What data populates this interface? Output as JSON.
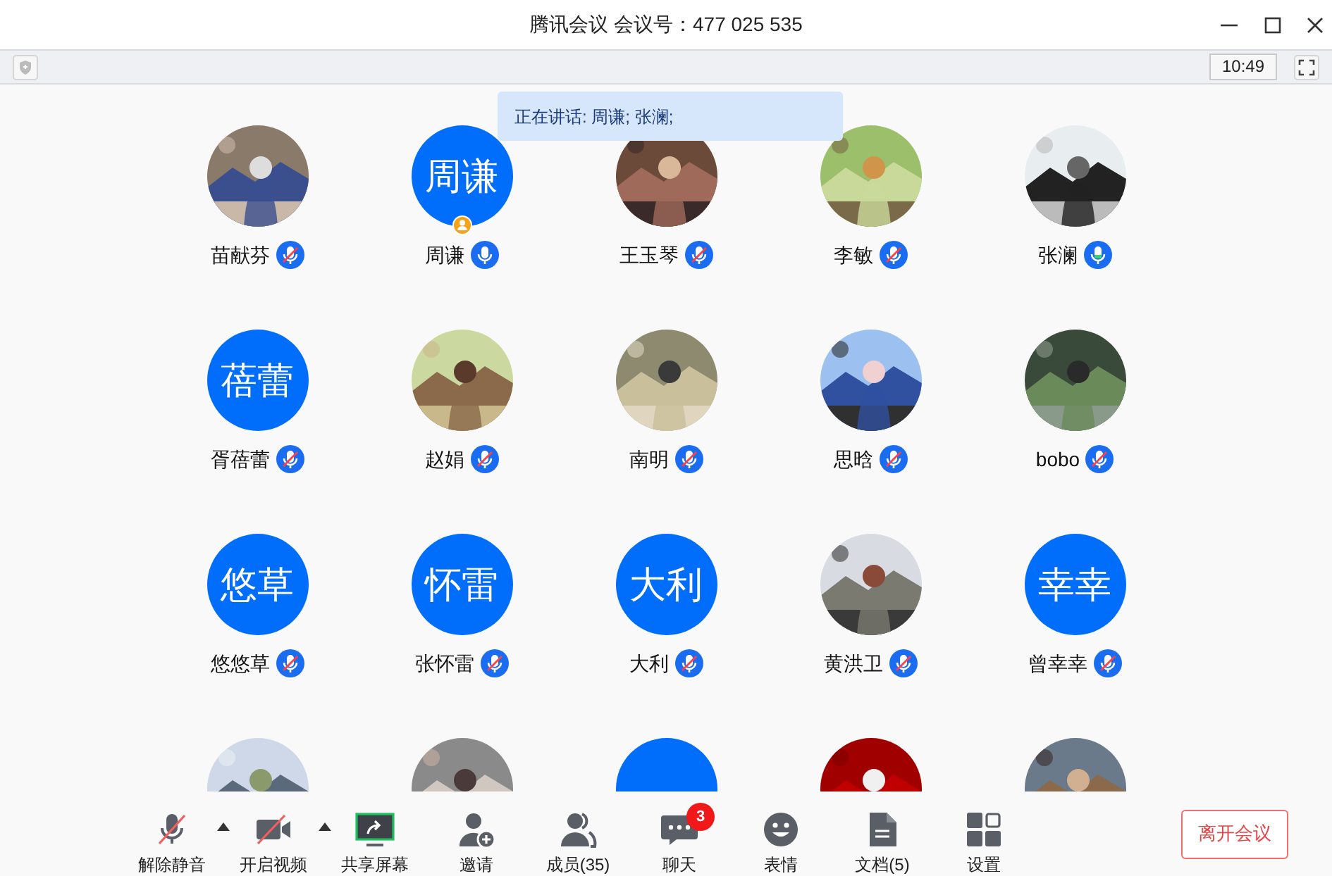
{
  "window": {
    "title": "腾讯会议 会议号：477 025 535"
  },
  "top_bar": {
    "time": "10:49"
  },
  "speaking_banner": "正在讲话: 周谦; 张澜;",
  "participants": [
    {
      "name": "苗献芬",
      "avatar": {
        "kind": "picture"
      },
      "muted": true,
      "host": false
    },
    {
      "name": "周谦",
      "avatar": {
        "kind": "initials",
        "text": "周谦"
      },
      "muted": false,
      "host": true
    },
    {
      "name": "王玉琴",
      "avatar": {
        "kind": "picture"
      },
      "muted": true,
      "host": false
    },
    {
      "name": "李敏",
      "avatar": {
        "kind": "picture"
      },
      "muted": true,
      "host": false
    },
    {
      "name": "张澜",
      "avatar": {
        "kind": "picture"
      },
      "muted": false,
      "host": false,
      "level": 0.3
    },
    {
      "name": "胥蓓蕾",
      "avatar": {
        "kind": "initials",
        "text": "蓓蕾"
      },
      "muted": true,
      "host": false
    },
    {
      "name": "赵娟",
      "avatar": {
        "kind": "picture"
      },
      "muted": true,
      "host": false
    },
    {
      "name": "南明",
      "avatar": {
        "kind": "picture"
      },
      "muted": true,
      "host": false
    },
    {
      "name": "思晗",
      "avatar": {
        "kind": "picture"
      },
      "muted": true,
      "host": false
    },
    {
      "name": "bobo",
      "avatar": {
        "kind": "picture"
      },
      "muted": true,
      "host": false
    },
    {
      "name": "悠悠草",
      "avatar": {
        "kind": "initials",
        "text": "悠草"
      },
      "muted": true,
      "host": false
    },
    {
      "name": "张怀雷",
      "avatar": {
        "kind": "initials",
        "text": "怀雷"
      },
      "muted": true,
      "host": false
    },
    {
      "name": "大利",
      "avatar": {
        "kind": "initials",
        "text": "大利"
      },
      "muted": true,
      "host": false
    },
    {
      "name": "黄洪卫",
      "avatar": {
        "kind": "picture"
      },
      "muted": true,
      "host": false
    },
    {
      "name": "曾幸幸",
      "avatar": {
        "kind": "initials",
        "text": "幸幸"
      },
      "muted": true,
      "host": false
    },
    {
      "avatar": {
        "kind": "picture"
      }
    },
    {
      "avatar": {
        "kind": "picture"
      }
    },
    {
      "avatar": {
        "kind": "initials"
      }
    },
    {
      "avatar": {
        "kind": "picture"
      }
    },
    {
      "avatar": {
        "kind": "picture"
      }
    }
  ],
  "toolbar": [
    {
      "kind": "mic",
      "label": "解除静音",
      "off": true,
      "menu": true
    },
    {
      "kind": "camera",
      "label": "开启视频",
      "off": true,
      "menu": true
    },
    {
      "kind": "share",
      "label": "共享屏幕"
    },
    {
      "kind": "invite",
      "label": "邀请"
    },
    {
      "kind": "members",
      "label": "成员(35)"
    },
    {
      "kind": "chat",
      "label": "聊天",
      "badge": "3"
    },
    {
      "kind": "emoji",
      "label": "表情"
    },
    {
      "kind": "docs",
      "label": "文档(5)"
    },
    {
      "kind": "settings",
      "label": "设置"
    }
  ],
  "leave_button": "离开会议"
}
